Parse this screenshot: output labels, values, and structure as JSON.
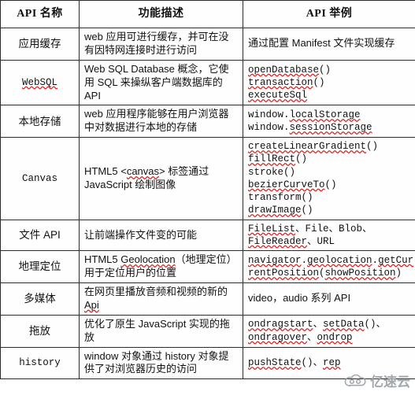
{
  "table": {
    "columns": [
      "API 名称",
      "功能描述",
      "API 举例"
    ],
    "rows": [
      {
        "name": "应用缓存",
        "name_mono": false,
        "desc": "web 应用可进行缓存，并可在没有因特网连接时进行访问",
        "example": "通过配置 Manifest 文件实现缓存",
        "example_cjk": true
      },
      {
        "name": "WebSQL",
        "name_mono": true,
        "desc": "Web SQL Database 概念，它使用 SQL 来操纵客户端数据库的 API",
        "example_lines": [
          "openDatabase()",
          "transaction()",
          "executeSql"
        ],
        "example_cjk": false
      },
      {
        "name": "本地存储",
        "name_mono": false,
        "desc": "web 应用程序能够在用户浏览器中对数据进行本地的存储",
        "example_lines": [
          "window.localStorage",
          "window.sessionStorage"
        ],
        "example_cjk": false
      },
      {
        "name": "Canvas",
        "name_mono": true,
        "desc": "HTML5 <canvas> 标签通过 JavaScript 绘制图像",
        "example_lines": [
          "createLinearGradient()",
          "fillRect()",
          "stroke()",
          "bezierCurveTo()",
          "transform()",
          "drawImage()"
        ],
        "example_cjk": false
      },
      {
        "name": "文件 API",
        "name_mono": false,
        "desc": "让前端操作文件变的可能",
        "example_lines": [
          "FileList、File、Blob、",
          "FileReader、URL"
        ],
        "example_cjk": false
      },
      {
        "name": "地理定位",
        "name_mono": false,
        "desc": "HTML5 Geolocation（地理定位）用于定位用户的位置",
        "example_lines": [
          "navigator.geolocation.getCur",
          "rentPosition(showPosition)"
        ],
        "example_cjk": false
      },
      {
        "name": "多媒体",
        "name_mono": false,
        "desc": "在网页里播放音频和视频的新的 Api",
        "example": "video，audio 系列 API",
        "example_cjk": true
      },
      {
        "name": "拖放",
        "name_mono": false,
        "desc": "优化了原生 JavaScript 实现的拖放",
        "example_lines": [
          "ondragstart、setData()、",
          "ondragover、ondrop"
        ],
        "example_cjk": false
      },
      {
        "name": "history",
        "name_mono": true,
        "desc": "window 对象通过 history 对象提供了对浏览器历史的访问",
        "example_lines": [
          "pushState()、rep"
        ],
        "example_cjk": false
      }
    ]
  },
  "watermark": {
    "text": "亿速云",
    "icon": "cloud-logo-icon",
    "color": "#9aa1a8"
  }
}
